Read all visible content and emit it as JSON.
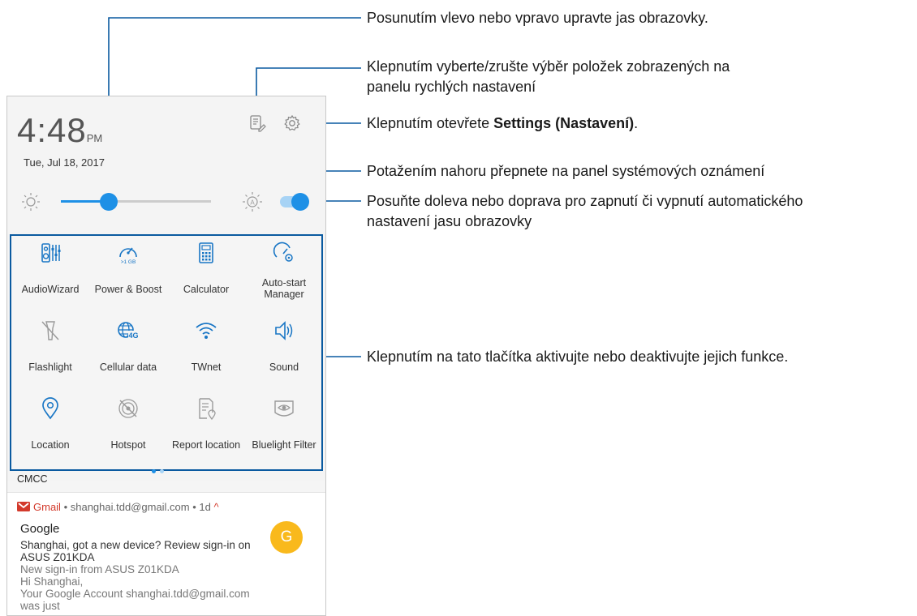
{
  "status": {
    "time": "4:48",
    "ampm": "PM",
    "date": "Tue, Jul 18, 2017"
  },
  "brightness": {
    "level": 0.32,
    "auto": true
  },
  "tiles": [
    {
      "label": "AudioWizard",
      "icon": "audiowizard-icon",
      "active": true
    },
    {
      "label": "Power & Boost",
      "icon": "power-boost-icon",
      "sub": ">1 GB",
      "active": true
    },
    {
      "label": "Calculator",
      "icon": "calculator-icon",
      "active": true
    },
    {
      "label": "Auto-start\nManager",
      "icon": "autostart-manager-icon",
      "active": true
    },
    {
      "label": "Flashlight",
      "icon": "flashlight-icon",
      "active": false
    },
    {
      "label": "Cellular data",
      "icon": "cellular-data-icon",
      "sub": "4G",
      "active": true
    },
    {
      "label": "TWnet",
      "icon": "wifi-icon",
      "active": true
    },
    {
      "label": "Sound",
      "icon": "sound-icon",
      "active": true
    },
    {
      "label": "Location",
      "icon": "location-icon",
      "active": true
    },
    {
      "label": "Hotspot",
      "icon": "hotspot-icon",
      "active": false
    },
    {
      "label": "Report location",
      "icon": "report-location-icon",
      "active": false
    },
    {
      "label": "Bluelight Filter",
      "icon": "bluelight-filter-icon",
      "active": false
    }
  ],
  "carrier": "CMCC",
  "notification": {
    "app": "Gmail",
    "account": "shanghai.tdd@gmail.com",
    "age": "1d",
    "sender": "Google",
    "lines": [
      "Shanghai, got a new device? Review sign-in on",
      "ASUS Z01KDA",
      "New sign-in from ASUS Z01KDA",
      "Hi Shanghai,",
      "Your Google Account shanghai.tdd@gmail.com was just"
    ],
    "avatar_letter": "G"
  },
  "callouts": {
    "brightness": "Posunutím vlevo nebo vpravo upravte jas obrazovky.",
    "edit_line1": "Klepnutím vyberte/zrušte výběr položek zobrazených na",
    "edit_line2": "panelu rychlých nastavení",
    "settings_pre": "Klepnutím otevřete ",
    "settings_bold": "Settings (Nastavení)",
    "settings_post": ".",
    "drag": "Potažením nahoru přepnete na panel systémových oznámení",
    "auto_line1": "Posuňte doleva nebo doprava pro zapnutí či vypnutí automatického",
    "auto_line2": "nastavení jasu obrazovky",
    "tiles": "Klepnutím na tato tlačítka aktivujte nebo deaktivujte jejich funkce."
  },
  "colors": {
    "accent": "#1e90e6",
    "active_icon": "#1976c5",
    "inactive_icon": "#9a9a9a",
    "leader": "#0a5aa0",
    "gmail": "#d33a2c",
    "avatar": "#f9b91c"
  }
}
